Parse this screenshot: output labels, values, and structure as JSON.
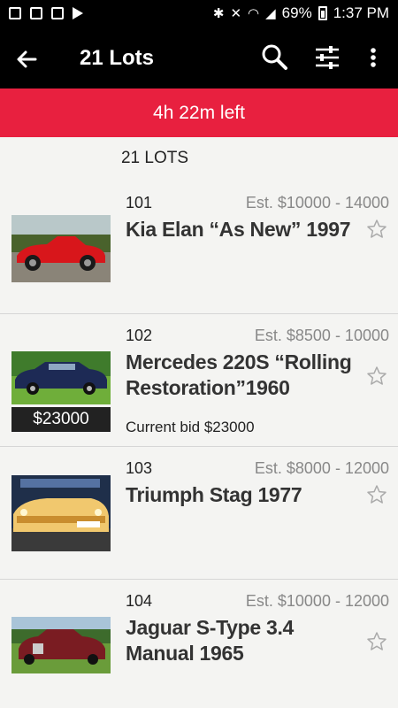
{
  "status_bar": {
    "battery": "69%",
    "time": "1:37 PM",
    "icons": [
      "gallery-icon",
      "image-icon",
      "calendar-icon",
      "play-store-icon",
      "bluetooth-icon",
      "mute-icon",
      "wifi-icon",
      "signal-icon",
      "battery-icon"
    ]
  },
  "app_bar": {
    "title": "21 Lots",
    "icons": [
      "back-arrow-icon",
      "search-icon",
      "filter-icon",
      "more-vert-icon"
    ]
  },
  "timer": {
    "text": "4h 22m  left"
  },
  "header": {
    "count": "21 LOTS"
  },
  "colors": {
    "accent": "#e8203f",
    "app_bar": "#000000",
    "background": "#f4f4f2"
  },
  "lots": [
    {
      "number": "101",
      "estimate": "Est. $10000 - 14000",
      "title": "Kia Elan “As New” 1997",
      "price": "",
      "current_bid": ""
    },
    {
      "number": "102",
      "estimate": "Est. $8500 - 10000",
      "title": "Mercedes 220S “Rolling Restoration”1960",
      "price": "$23000",
      "current_bid": "Current bid $23000"
    },
    {
      "number": "103",
      "estimate": "Est. $8000 - 12000",
      "title": "Triumph Stag 1977",
      "price": "",
      "current_bid": ""
    },
    {
      "number": "104",
      "estimate": "Est. $10000 - 12000",
      "title": "Jaguar S-Type 3.4 Manual 1965",
      "price": "",
      "current_bid": ""
    }
  ]
}
